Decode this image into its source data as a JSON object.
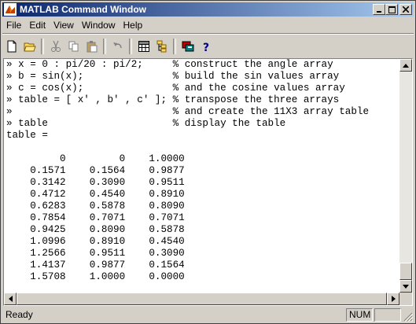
{
  "window": {
    "title": "MATLAB Command Window"
  },
  "menu": [
    "File",
    "Edit",
    "View",
    "Window",
    "Help"
  ],
  "toolbar": [
    "new-file-icon",
    "open-folder-icon",
    "cut-icon",
    "copy-icon",
    "paste-icon",
    "undo-icon",
    "workspace-browser-icon",
    "path-browser-icon",
    "simulink-icon",
    "help-icon"
  ],
  "console": {
    "lines": [
      "» x = 0 : pi/20 : pi/2;     % construct the angle array",
      "» b = sin(x);               % build the sin values array",
      "» c = cos(x);               % and the cosine values array",
      "» table = [ x' , b' , c' ]; % transpose the three arrays",
      "»                           % and create the 11X3 array table",
      "» table                     % display the table",
      "table =",
      "",
      "         0         0    1.0000",
      "    0.1571    0.1564    0.9877",
      "    0.3142    0.3090    0.9511",
      "    0.4712    0.4540    0.8910",
      "    0.6283    0.5878    0.8090",
      "    0.7854    0.7071    0.7071",
      "    0.9425    0.8090    0.5878",
      "    1.0996    0.8910    0.4540",
      "    1.2566    0.9511    0.3090",
      "    1.4137    0.9877    0.1564",
      "    1.5708    1.0000    0.0000",
      "",
      "»"
    ]
  },
  "status": {
    "left": "Ready",
    "num": "NUM"
  }
}
